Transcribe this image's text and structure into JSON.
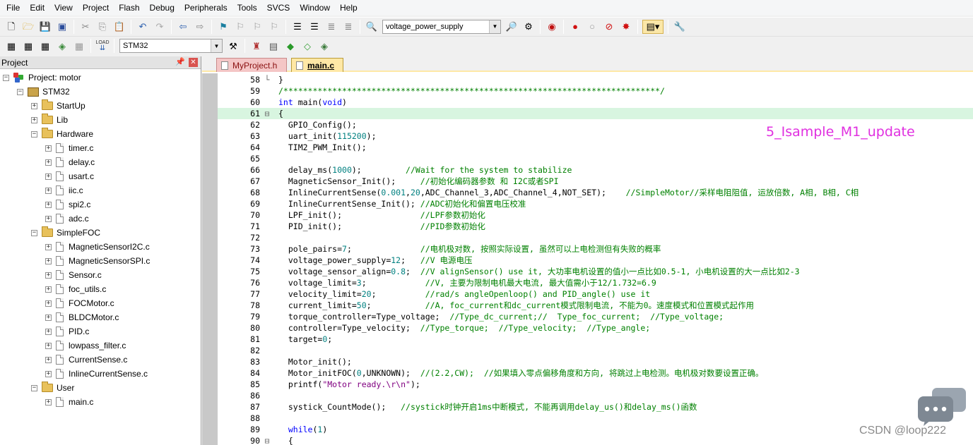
{
  "menu": [
    "File",
    "Edit",
    "View",
    "Project",
    "Flash",
    "Debug",
    "Peripherals",
    "Tools",
    "SVCS",
    "Window",
    "Help"
  ],
  "toolbar1": {
    "target_combo_value": "voltage_power_supply"
  },
  "toolbar2": {
    "target_select_value": "STM32",
    "load_label": "LOAD"
  },
  "project_panel": {
    "title": "Project",
    "pin": "ᵖ",
    "close": "✕",
    "tree": [
      {
        "label": "Project: motor",
        "type": "project",
        "expander": "−"
      },
      {
        "label": "STM32",
        "type": "target",
        "expander": "−"
      },
      {
        "label": "StartUp",
        "type": "folder",
        "expander": "+"
      },
      {
        "label": "Lib",
        "type": "folder",
        "expander": "+"
      },
      {
        "label": "Hardware",
        "type": "folder",
        "expander": "−"
      },
      {
        "label": "timer.c",
        "type": "file",
        "expander": "+"
      },
      {
        "label": "delay.c",
        "type": "file",
        "expander": "+"
      },
      {
        "label": "usart.c",
        "type": "file",
        "expander": "+"
      },
      {
        "label": "iic.c",
        "type": "file",
        "expander": "+"
      },
      {
        "label": "spi2.c",
        "type": "file",
        "expander": "+"
      },
      {
        "label": "adc.c",
        "type": "file",
        "expander": "+"
      },
      {
        "label": "SimpleFOC",
        "type": "folder",
        "expander": "−"
      },
      {
        "label": "MagneticSensorI2C.c",
        "type": "file",
        "expander": "+"
      },
      {
        "label": "MagneticSensorSPI.c",
        "type": "file",
        "expander": "+"
      },
      {
        "label": "Sensor.c",
        "type": "file",
        "expander": "+"
      },
      {
        "label": "foc_utils.c",
        "type": "file",
        "expander": "+"
      },
      {
        "label": "FOCMotor.c",
        "type": "file",
        "expander": "+"
      },
      {
        "label": "BLDCMotor.c",
        "type": "file",
        "expander": "+"
      },
      {
        "label": "PID.c",
        "type": "file",
        "expander": "+"
      },
      {
        "label": "lowpass_filter.c",
        "type": "file",
        "expander": "+"
      },
      {
        "label": "CurrentSense.c",
        "type": "file",
        "expander": "+"
      },
      {
        "label": "InlineCurrentSense.c",
        "type": "file",
        "expander": "+"
      },
      {
        "label": "User",
        "type": "folder",
        "expander": "−"
      },
      {
        "label": "main.c",
        "type": "file",
        "expander": "+"
      }
    ]
  },
  "editor": {
    "tabs": [
      {
        "label": "MyProject.h",
        "active": false
      },
      {
        "label": "main.c",
        "active": true
      }
    ],
    "annotation": "5_Isample_M1_update",
    "current_line": "61",
    "lines": [
      {
        "n": "58",
        "fold": "└",
        "parts": [
          {
            "t": "}",
            "c": ""
          }
        ]
      },
      {
        "n": "59",
        "fold": "",
        "parts": [
          {
            "t": "/*****************************************************************************/",
            "c": "cmt"
          }
        ]
      },
      {
        "n": "60",
        "fold": "",
        "parts": [
          {
            "t": "int",
            "c": "kw"
          },
          {
            "t": " main(",
            "c": ""
          },
          {
            "t": "void",
            "c": "kw"
          },
          {
            "t": ")",
            "c": ""
          }
        ]
      },
      {
        "n": "61",
        "fold": "⊟",
        "parts": [
          {
            "t": "{",
            "c": ""
          }
        ]
      },
      {
        "n": "62",
        "fold": "",
        "parts": [
          {
            "t": "  GPIO_Config();",
            "c": ""
          }
        ]
      },
      {
        "n": "63",
        "fold": "",
        "parts": [
          {
            "t": "  uart_init(",
            "c": ""
          },
          {
            "t": "115200",
            "c": "num"
          },
          {
            "t": ");",
            "c": ""
          }
        ]
      },
      {
        "n": "64",
        "fold": "",
        "parts": [
          {
            "t": "  TIM2_PWM_Init();",
            "c": ""
          }
        ]
      },
      {
        "n": "65",
        "fold": "",
        "parts": []
      },
      {
        "n": "66",
        "fold": "",
        "parts": [
          {
            "t": "  delay_ms(",
            "c": ""
          },
          {
            "t": "1000",
            "c": "num"
          },
          {
            "t": ");         ",
            "c": ""
          },
          {
            "t": "//Wait for the system to stabilize",
            "c": "cmt"
          }
        ]
      },
      {
        "n": "67",
        "fold": "",
        "parts": [
          {
            "t": "  MagneticSensor_Init();     ",
            "c": ""
          },
          {
            "t": "//初始化编码器参数 和 I2C或者SPI",
            "c": "cmt"
          }
        ]
      },
      {
        "n": "68",
        "fold": "",
        "parts": [
          {
            "t": "  InlineCurrentSense(",
            "c": ""
          },
          {
            "t": "0.001",
            "c": "num"
          },
          {
            "t": ",",
            "c": ""
          },
          {
            "t": "20",
            "c": "num"
          },
          {
            "t": ",ADC_Channel_3,ADC_Channel_4,NOT_SET);    ",
            "c": ""
          },
          {
            "t": "//SimpleMotor//采样电阻阻值, 运放倍数, A相, B相, C相",
            "c": "cmt"
          }
        ]
      },
      {
        "n": "69",
        "fold": "",
        "parts": [
          {
            "t": "  InlineCurrentSense_Init(); ",
            "c": ""
          },
          {
            "t": "//ADC初始化和偏置电压校准",
            "c": "cmt"
          }
        ]
      },
      {
        "n": "70",
        "fold": "",
        "parts": [
          {
            "t": "  LPF_init();                ",
            "c": ""
          },
          {
            "t": "//LPF参数初始化",
            "c": "cmt"
          }
        ]
      },
      {
        "n": "71",
        "fold": "",
        "parts": [
          {
            "t": "  PID_init();                ",
            "c": ""
          },
          {
            "t": "//PID参数初始化",
            "c": "cmt"
          }
        ]
      },
      {
        "n": "72",
        "fold": "",
        "parts": []
      },
      {
        "n": "73",
        "fold": "",
        "parts": [
          {
            "t": "  pole_pairs=",
            "c": ""
          },
          {
            "t": "7",
            "c": "num"
          },
          {
            "t": ";              ",
            "c": ""
          },
          {
            "t": "//电机极对数, 按照实际设置, 虽然可以上电检测但有失败的概率",
            "c": "cmt"
          }
        ]
      },
      {
        "n": "74",
        "fold": "",
        "parts": [
          {
            "t": "  voltage_power_supply=",
            "c": ""
          },
          {
            "t": "12",
            "c": "num"
          },
          {
            "t": ";   ",
            "c": ""
          },
          {
            "t": "//V 电源电压",
            "c": "cmt"
          }
        ]
      },
      {
        "n": "75",
        "fold": "",
        "parts": [
          {
            "t": "  voltage_sensor_align=",
            "c": ""
          },
          {
            "t": "0.8",
            "c": "num"
          },
          {
            "t": ";  ",
            "c": ""
          },
          {
            "t": "//V alignSensor() use it, 大功率电机设置的值小一点比如0.5-1, 小电机设置的大一点比如2-3",
            "c": "cmt"
          }
        ]
      },
      {
        "n": "76",
        "fold": "",
        "parts": [
          {
            "t": "  voltage_limit=",
            "c": ""
          },
          {
            "t": "3",
            "c": "num"
          },
          {
            "t": ";            ",
            "c": ""
          },
          {
            "t": "//V, 主要为限制电机最大电流, 最大值需小于12/1.732=6.9",
            "c": "cmt"
          }
        ]
      },
      {
        "n": "77",
        "fold": "",
        "parts": [
          {
            "t": "  velocity_limit=",
            "c": ""
          },
          {
            "t": "20",
            "c": "num"
          },
          {
            "t": ";          ",
            "c": ""
          },
          {
            "t": "//rad/s angleOpenloop() and PID_angle() use it",
            "c": "cmt"
          }
        ]
      },
      {
        "n": "78",
        "fold": "",
        "parts": [
          {
            "t": "  current_limit=",
            "c": ""
          },
          {
            "t": "50",
            "c": "num"
          },
          {
            "t": ";           ",
            "c": ""
          },
          {
            "t": "//A, foc_current和dc_current模式限制电流, 不能为0。速度模式和位置模式起作用",
            "c": "cmt"
          }
        ]
      },
      {
        "n": "79",
        "fold": "",
        "parts": [
          {
            "t": "  torque_controller=Type_voltage;  ",
            "c": ""
          },
          {
            "t": "//Type_dc_current;//  Type_foc_current;  //Type_voltage;",
            "c": "cmt"
          }
        ]
      },
      {
        "n": "80",
        "fold": "",
        "parts": [
          {
            "t": "  controller=Type_velocity;  ",
            "c": ""
          },
          {
            "t": "//Type_torque;  //Type_velocity;  //Type_angle;",
            "c": "cmt"
          }
        ]
      },
      {
        "n": "81",
        "fold": "",
        "parts": [
          {
            "t": "  target=",
            "c": ""
          },
          {
            "t": "0",
            "c": "num"
          },
          {
            "t": ";",
            "c": ""
          }
        ]
      },
      {
        "n": "82",
        "fold": "",
        "parts": []
      },
      {
        "n": "83",
        "fold": "",
        "parts": [
          {
            "t": "  Motor_init();",
            "c": ""
          }
        ]
      },
      {
        "n": "84",
        "fold": "",
        "parts": [
          {
            "t": "  Motor_initFOC(",
            "c": ""
          },
          {
            "t": "0",
            "c": "num"
          },
          {
            "t": ",UNKNOWN);  ",
            "c": ""
          },
          {
            "t": "//(2.2,CW);  //如果填入零点偏移角度和方向, 将跳过上电检测。电机极对数要设置正确。",
            "c": "cmt"
          }
        ]
      },
      {
        "n": "85",
        "fold": "",
        "parts": [
          {
            "t": "  printf(",
            "c": ""
          },
          {
            "t": "\"Motor ready.\\r\\n\"",
            "c": "str"
          },
          {
            "t": ");",
            "c": ""
          }
        ]
      },
      {
        "n": "86",
        "fold": "",
        "parts": []
      },
      {
        "n": "87",
        "fold": "",
        "parts": [
          {
            "t": "  systick_CountMode();   ",
            "c": ""
          },
          {
            "t": "//systick时钟开启1ms中断模式, 不能再调用delay_us()和delay_ms()函数",
            "c": "cmt"
          }
        ]
      },
      {
        "n": "88",
        "fold": "",
        "parts": []
      },
      {
        "n": "89",
        "fold": "",
        "parts": [
          {
            "t": "  ",
            "c": ""
          },
          {
            "t": "while",
            "c": "kw"
          },
          {
            "t": "(",
            "c": ""
          },
          {
            "t": "1",
            "c": "num"
          },
          {
            "t": ")",
            "c": ""
          }
        ]
      },
      {
        "n": "90",
        "fold": "⊟",
        "parts": [
          {
            "t": "  {",
            "c": ""
          }
        ]
      }
    ]
  },
  "watermark": {
    "text": "CSDN @loop222"
  },
  "colors": {
    "keyword": "#0000ff",
    "number": "#008080",
    "comment": "#008000",
    "string": "#800080",
    "annotation": "#e030e0",
    "current_line_bg": "#d8f5e0"
  }
}
